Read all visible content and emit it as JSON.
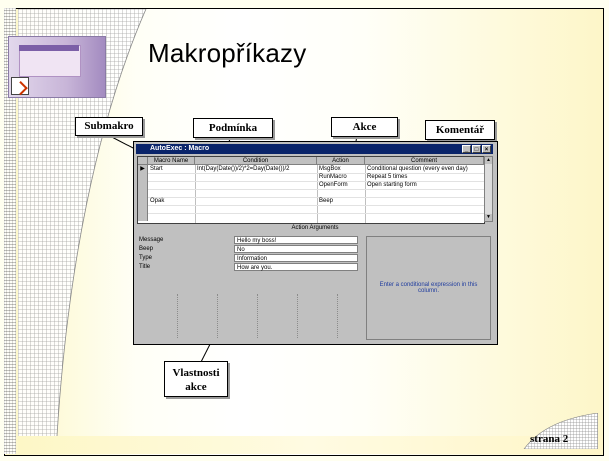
{
  "slide": {
    "title": "Makropříkazy",
    "page_label": "strana 2"
  },
  "callouts": {
    "submakro": "Submakro",
    "podminka": "Podmínka",
    "akce": "Akce",
    "komentar": "Komentář",
    "vlastnosti_line1": "Vlastnosti",
    "vlastnosti_line2": "akce"
  },
  "window": {
    "title": "AutoExec : Macro",
    "minimize": "_",
    "maximize": "□",
    "close": "×"
  },
  "grid": {
    "headers": [
      "Macro Name",
      "Condition",
      "Action",
      "Comment"
    ],
    "rows": [
      {
        "name": "Start",
        "condition": "Int(Day(Date())/2)*2=Day(Date())/2",
        "action": "MsgBox",
        "comment": "Conditional question (every even day)"
      },
      {
        "name": "",
        "condition": "",
        "action": "RunMacro",
        "comment": "Repeat 5 times"
      },
      {
        "name": "",
        "condition": "",
        "action": "OpenForm",
        "comment": "Open starting form"
      },
      {
        "name": "Opak",
        "condition": "",
        "action": "Beep",
        "comment": ""
      }
    ],
    "row_indicator": "▶"
  },
  "arguments": {
    "header": "Action Arguments",
    "items": [
      {
        "label": "Message",
        "value": "Hello my boss!"
      },
      {
        "label": "Beep",
        "value": "No"
      },
      {
        "label": "Type",
        "value": "Information"
      },
      {
        "label": "Title",
        "value": "How are you."
      }
    ],
    "help_text": "Enter a conditional expression in this column."
  }
}
